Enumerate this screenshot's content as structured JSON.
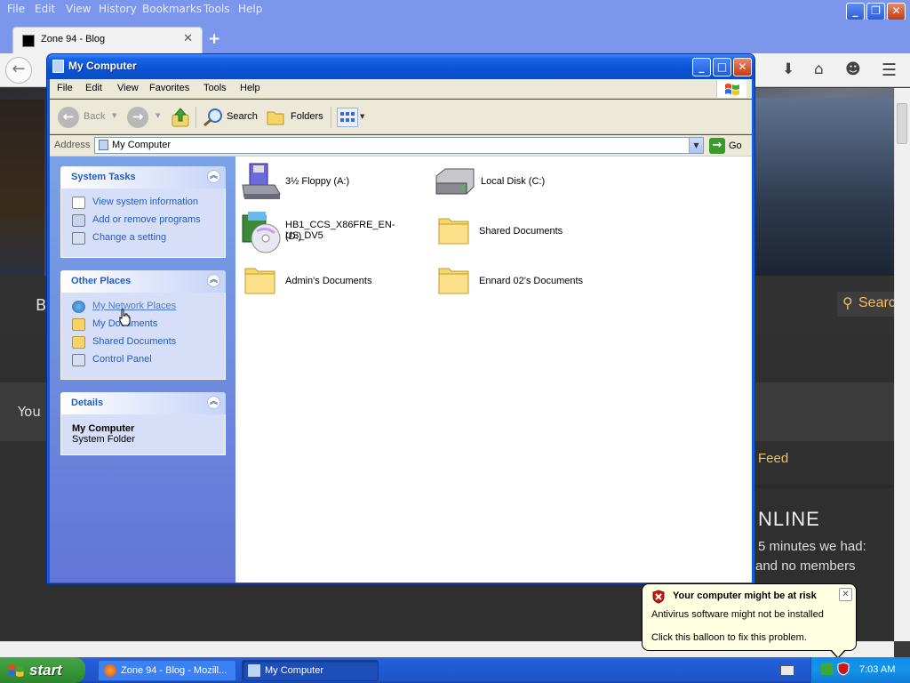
{
  "browser": {
    "menu": [
      "File",
      "Edit",
      "View",
      "History",
      "Bookmarks",
      "Tools",
      "Help"
    ],
    "tab_title": "Zone 94 - Blog",
    "tab_close": "✕",
    "new_tab": "+"
  },
  "website": {
    "menu_letter": "B",
    "search_label": "Searc",
    "welcome_fragment": "You",
    "feed_label": "Feed",
    "online_heading": "NLINE",
    "online_text_1": "5 minutes we had:",
    "online_text_2": "and no members"
  },
  "window": {
    "title": "My Computer",
    "menu": [
      "File",
      "Edit",
      "View",
      "Favorites",
      "Tools",
      "Help"
    ],
    "toolbar": {
      "back": "Back",
      "search": "Search",
      "folders": "Folders"
    },
    "address_label": "Address",
    "address_value": "My Computer",
    "go_label": "Go",
    "panels": {
      "system_tasks": {
        "title": "System Tasks",
        "items": [
          "View system information",
          "Add or remove programs",
          "Change a setting"
        ]
      },
      "other_places": {
        "title": "Other Places",
        "items": [
          "My Network Places",
          "My Documents",
          "Shared Documents",
          "Control Panel"
        ]
      },
      "details": {
        "title": "Details",
        "name": "My Computer",
        "type": "System Folder"
      }
    },
    "items": [
      {
        "label": "3½ Floppy (A:)",
        "icon": "floppy-icon"
      },
      {
        "label": "Local Disk (C:)",
        "icon": "hard-disk-icon"
      },
      {
        "label": "HB1_CCS_X86FRE_EN-US_DV5",
        "label2": "(D:)",
        "icon": "cd-drive-icon"
      },
      {
        "label": "Shared Documents",
        "icon": "folder-icon"
      },
      {
        "label": "Admin's Documents",
        "icon": "folder-icon"
      },
      {
        "label": "Ennard 02's Documents",
        "icon": "folder-icon"
      }
    ]
  },
  "balloon": {
    "title": "Your computer might be at risk",
    "line1": "Antivirus software might not be installed",
    "line2": "Click this balloon to fix this problem."
  },
  "taskbar": {
    "start": "start",
    "buttons": [
      "Zone 94 - Blog - Mozill...",
      "My Computer"
    ],
    "clock": "7:03 AM"
  },
  "colors": {
    "xp_blue": "#0b5ce0",
    "task_link": "#215dc6",
    "balloon_bg": "#ffffe1"
  }
}
